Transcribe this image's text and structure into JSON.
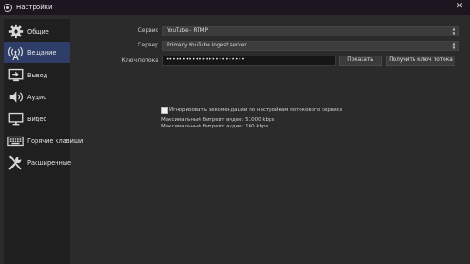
{
  "window": {
    "title": "Настройки",
    "close_glyph": "✕"
  },
  "sidebar": {
    "items": [
      {
        "label": "Общие",
        "icon": "gear-icon"
      },
      {
        "label": "Вещание",
        "icon": "broadcast-icon",
        "active": true
      },
      {
        "label": "Вывод",
        "icon": "output-icon"
      },
      {
        "label": "Аудио",
        "icon": "speaker-icon"
      },
      {
        "label": "Видео",
        "icon": "monitor-icon"
      },
      {
        "label": "Горячие клавиши",
        "icon": "keyboard-icon"
      },
      {
        "label": "Расширенные",
        "icon": "tools-icon"
      }
    ]
  },
  "stream": {
    "service_label": "Сервис",
    "service_value": "YouTube - RTMP",
    "server_label": "Сервер",
    "server_value": "Primary YouTube ingest server",
    "key_label": "Ключ потока",
    "key_value": "••••••••••••••••••••••••",
    "show_button": "Показать",
    "get_key_button": "Получить ключ потока",
    "ignore_checkbox_label": "Игнорировать рекомендации по настройкам потокового сервиса",
    "ignore_checked": false,
    "max_video_bitrate": "Максимальный битрейт видео: 51000 kbps",
    "max_audio_bitrate": "Максимальный битрейт аудио: 160 kbps"
  },
  "colors": {
    "titlebar": "#1d1520",
    "background": "#2b2b2b",
    "sidebar": "#1f1f1f",
    "active_item": "#2f3d69"
  }
}
